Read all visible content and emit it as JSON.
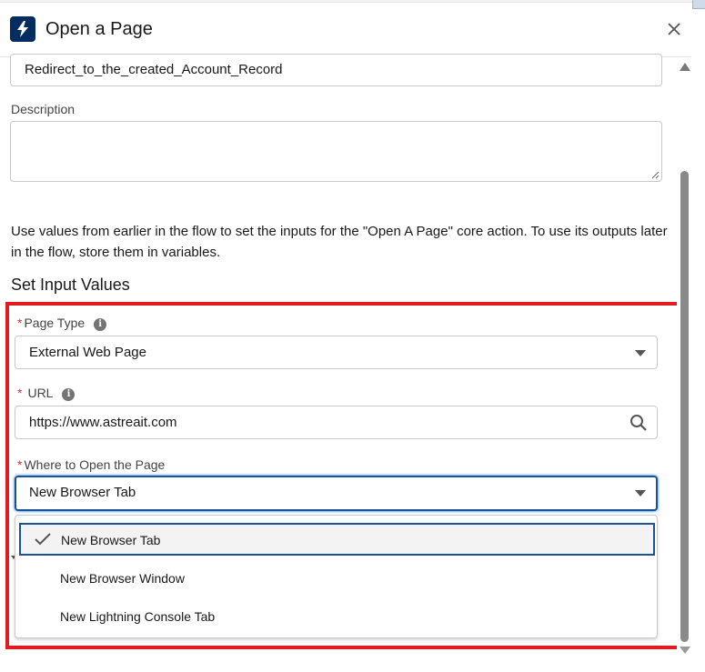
{
  "header": {
    "title": "Open a Page",
    "icon": "lightning-bolt-icon",
    "icon_bg": "#032d60"
  },
  "fields": {
    "api_name_value": "Redirect_to_the_created_Account_Record",
    "description_label": "Description",
    "description_value": ""
  },
  "help_text": "Use values from earlier in the flow to set the inputs for the \"Open A Page\" core action. To use its outputs later in the flow, store them in variables.",
  "section_title": "Set Input Values",
  "inputs": {
    "page_type": {
      "label": "Page Type",
      "required_mark": "*",
      "value": "External Web Page"
    },
    "url": {
      "label": "URL",
      "required_mark": "*",
      "value": "https://www.astreait.com"
    },
    "where_to_open": {
      "label": "Where to Open the Page",
      "required_mark": "*",
      "value": "New Browser Tab"
    }
  },
  "dropdown": {
    "options": [
      {
        "label": "New Browser Tab",
        "selected": true
      },
      {
        "label": "New Browser Window",
        "selected": false
      },
      {
        "label": "New Lightning Console Tab",
        "selected": false
      }
    ]
  },
  "colors": {
    "highlight": "#e21b23",
    "focus": "#1b5297",
    "required": "#c23934"
  }
}
